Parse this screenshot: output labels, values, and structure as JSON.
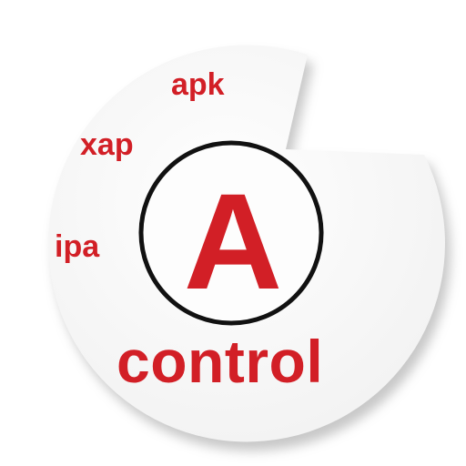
{
  "brand": {
    "accent_color": "#d21f26",
    "ring_color": "#111111",
    "disc_color": "#fbfbfb",
    "shadow_color": "#b5b5b5"
  },
  "logo": {
    "letter": "A",
    "word": "control"
  },
  "extensions": [
    "apk",
    "xap",
    "ipa"
  ]
}
